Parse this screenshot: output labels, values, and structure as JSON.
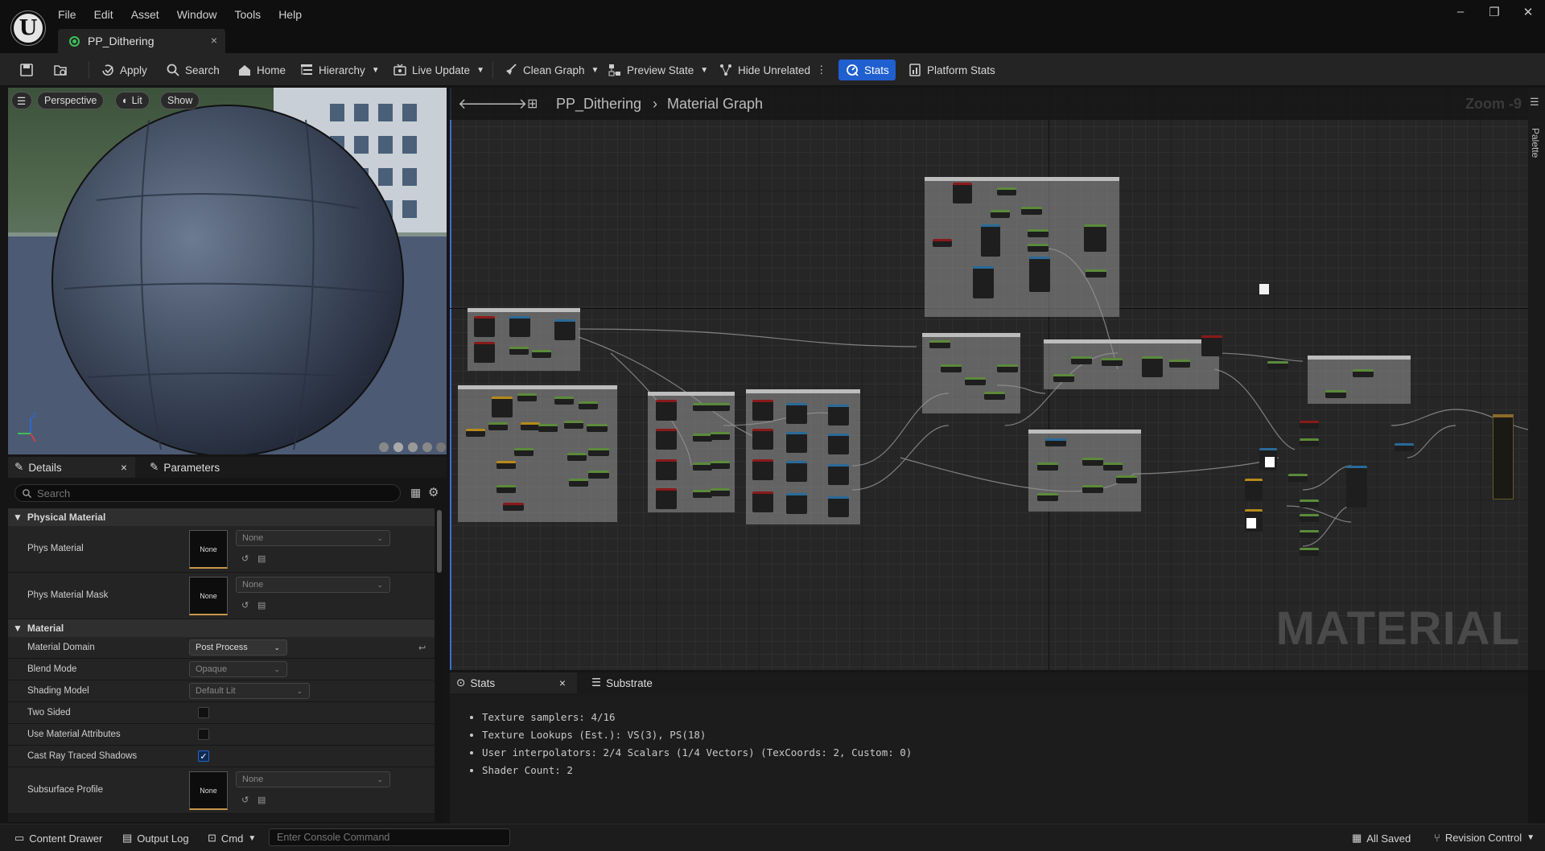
{
  "menu": {
    "items": [
      "File",
      "Edit",
      "Asset",
      "Window",
      "Tools",
      "Help"
    ]
  },
  "document_tab": {
    "title": "PP_Dithering",
    "close": "×"
  },
  "window_controls": {
    "minimize": "–",
    "maximize": "❐",
    "close": "✕"
  },
  "toolbar": {
    "apply": "Apply",
    "search": "Search",
    "home": "Home",
    "hierarchy": "Hierarchy",
    "live_update": "Live Update",
    "clean_graph": "Clean Graph",
    "preview_state": "Preview State",
    "hide_unrelated": "Hide Unrelated",
    "stats": "Stats",
    "platform_stats": "Platform Stats"
  },
  "viewport": {
    "perspective": "Perspective",
    "lit": "Lit",
    "show": "Show"
  },
  "panel_tabs": {
    "details": "Details",
    "parameters": "Parameters",
    "close": "×"
  },
  "details": {
    "search_placeholder": "Search",
    "physical_material": {
      "header": "Physical Material",
      "phys_material": {
        "label": "Phys Material",
        "thumb": "None",
        "value": "None"
      },
      "phys_material_mask": {
        "label": "Phys Material Mask",
        "thumb": "None",
        "value": "None"
      }
    },
    "material": {
      "header": "Material",
      "material_domain": {
        "label": "Material Domain",
        "value": "Post Process"
      },
      "blend_mode": {
        "label": "Blend Mode",
        "value": "Opaque"
      },
      "shading_model": {
        "label": "Shading Model",
        "value": "Default Lit"
      },
      "two_sided": {
        "label": "Two Sided",
        "checked": false
      },
      "use_material_attributes": {
        "label": "Use Material Attributes",
        "checked": false
      },
      "cast_ray_traced_shadows": {
        "label": "Cast Ray Traced Shadows",
        "checked": true
      },
      "subsurface_profile": {
        "label": "Subsurface Profile",
        "thumb": "None",
        "value": "None"
      }
    }
  },
  "graph": {
    "breadcrumb_root": "PP_Dithering",
    "breadcrumb_sep": "›",
    "breadcrumb_current": "Material Graph",
    "zoom": "Zoom -9",
    "watermark": "MATERIAL",
    "palette": "Palette"
  },
  "bottom_tabs": {
    "stats": "Stats",
    "substrate": "Substrate",
    "close": "×"
  },
  "stats": {
    "lines": [
      "Texture samplers: 4/16",
      "Texture Lookups (Est.): VS(3), PS(18)",
      "User interpolators: 2/4 Scalars (1/4 Vectors) (TexCoords: 2, Custom: 0)",
      "Shader Count: 2"
    ]
  },
  "statusbar": {
    "content_drawer": "Content Drawer",
    "output_log": "Output Log",
    "cmd": "Cmd",
    "console_placeholder": "Enter Console Command",
    "all_saved": "All Saved",
    "revision_control": "Revision Control"
  },
  "colors": {
    "accent": "#1f5fcf",
    "check": "#2a66c7",
    "thumb_border": "#c8964a"
  }
}
